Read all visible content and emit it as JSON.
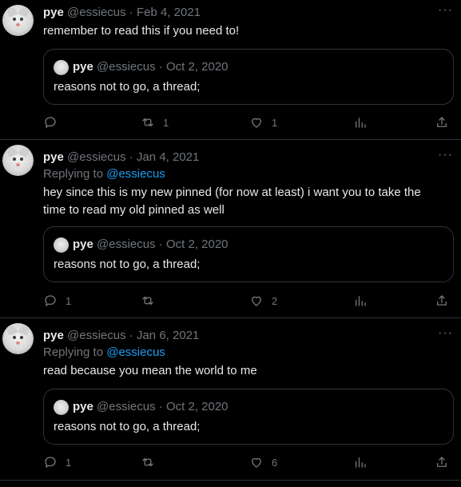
{
  "tweets": [
    {
      "name": "pye",
      "handle": "@essiecus",
      "dot": "·",
      "date": "Feb 4, 2021",
      "more": "···",
      "reply_prefix": "",
      "reply_handle": "",
      "text": "remember to read this if you need to!",
      "quote": {
        "name": "pye",
        "handle": "@essiecus",
        "dot": "·",
        "date": "Oct 2, 2020",
        "text": "reasons not to go, a thread;"
      },
      "counts": {
        "reply": "",
        "retweet": "1",
        "like": "1"
      }
    },
    {
      "name": "pye",
      "handle": "@essiecus",
      "dot": "·",
      "date": "Jan 4, 2021",
      "more": "···",
      "reply_prefix": "Replying to",
      "reply_handle": "@essiecus",
      "text": "hey since this is my new pinned (for now at least) i want you to take the time to read my old pinned as well",
      "quote": {
        "name": "pye",
        "handle": "@essiecus",
        "dot": "·",
        "date": "Oct 2, 2020",
        "text": "reasons not to go, a thread;"
      },
      "counts": {
        "reply": "1",
        "retweet": "",
        "like": "2"
      }
    },
    {
      "name": "pye",
      "handle": "@essiecus",
      "dot": "·",
      "date": "Jan 6, 2021",
      "more": "···",
      "reply_prefix": "Replying to",
      "reply_handle": "@essiecus",
      "text": "read because you mean the world to me",
      "quote": {
        "name": "pye",
        "handle": "@essiecus",
        "dot": "·",
        "date": "Oct 2, 2020",
        "text": "reasons not to go, a thread;"
      },
      "counts": {
        "reply": "1",
        "retweet": "",
        "like": "6"
      }
    }
  ],
  "icons": {
    "reply": "reply-icon",
    "retweet": "retweet-icon",
    "like": "heart-icon",
    "views": "views-icon",
    "share": "share-icon"
  },
  "colors": {
    "background": "#000000",
    "text": "#e7e9ea",
    "muted": "#71767b",
    "link": "#1d9bf0",
    "border": "#2f3336"
  }
}
